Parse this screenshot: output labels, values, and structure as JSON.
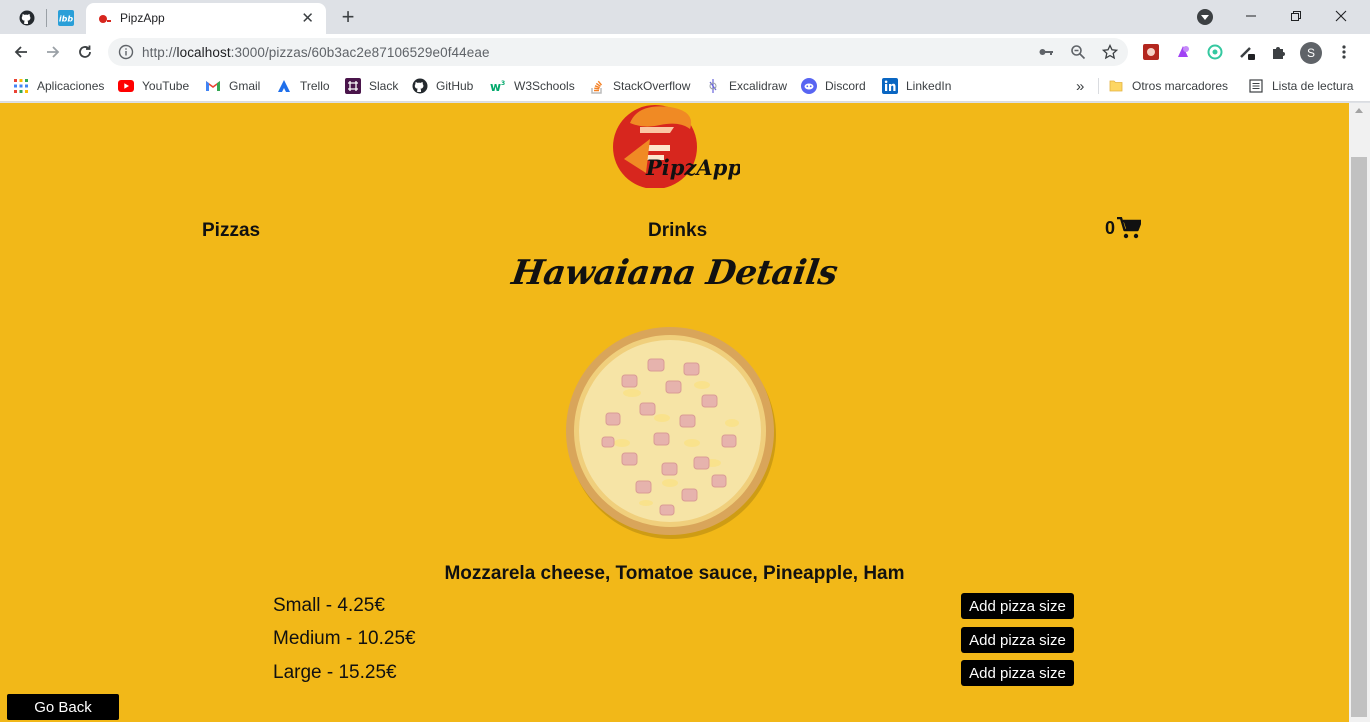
{
  "browser": {
    "tab_title": "PipzApp",
    "url_host": "localhost",
    "url_rest": ":3000/pizzas/60b3ac2e87106529e0f44eae",
    "url_scheme": "http://",
    "avatar_letter": "S"
  },
  "bookmarks": {
    "items": [
      {
        "label": "Aplicaciones",
        "icon": "apps-grid-icon"
      },
      {
        "label": "YouTube",
        "icon": "youtube-icon"
      },
      {
        "label": "Gmail",
        "icon": "gmail-icon"
      },
      {
        "label": "Trello",
        "icon": "trello-icon"
      },
      {
        "label": "Slack",
        "icon": "slack-icon"
      },
      {
        "label": "GitHub",
        "icon": "github-icon"
      },
      {
        "label": "W3Schools",
        "icon": "w3schools-icon"
      },
      {
        "label": "StackOverflow",
        "icon": "stackoverflow-icon"
      },
      {
        "label": "Excalidraw",
        "icon": "excalidraw-icon"
      },
      {
        "label": "Discord",
        "icon": "discord-icon"
      },
      {
        "label": "LinkedIn",
        "icon": "linkedin-icon"
      }
    ],
    "overflow": "»",
    "other": "Otros marcadores",
    "reading_list": "Lista de lectura"
  },
  "app": {
    "logo_text": "PipzApp",
    "nav": {
      "pizzas": "Pizzas",
      "drinks": "Drinks"
    },
    "cart_count": "0",
    "title": "Hawaiana Details",
    "ingredients": "Mozzarela cheese, Tomatoe sauce, Pineapple, Ham",
    "sizes": [
      {
        "label": "Small - 4.25€",
        "button": "Add pizza size"
      },
      {
        "label": "Medium - 10.25€",
        "button": "Add pizza size"
      },
      {
        "label": "Large - 15.25€",
        "button": "Add pizza size"
      }
    ],
    "go_back": "Go Back",
    "colors": {
      "background": "#f2b818",
      "button": "#000000",
      "logo_red": "#d7261e"
    }
  }
}
